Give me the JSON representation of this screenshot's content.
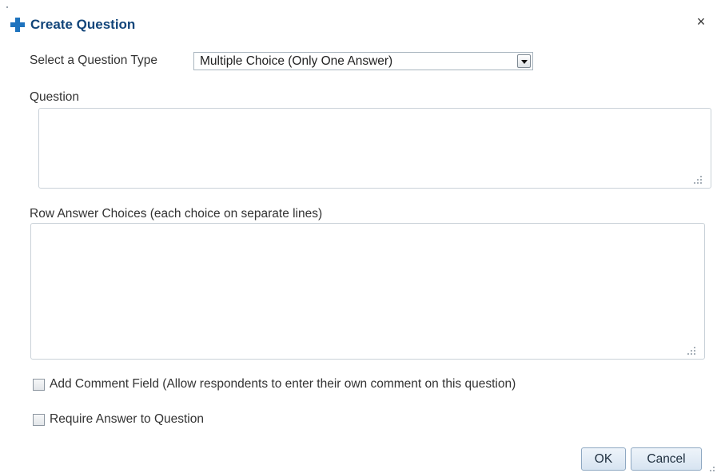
{
  "dialog": {
    "title": "Create Question",
    "close_symbol": "×",
    "icons": {
      "title_icon": "plus-icon",
      "close_icon": "close-icon"
    }
  },
  "question_type": {
    "label": "Select a Question Type",
    "selected": "Multiple Choice (Only One Answer)"
  },
  "question": {
    "label": "Question",
    "value": ""
  },
  "answers": {
    "label": "Row Answer Choices (each choice on separate lines)",
    "value": ""
  },
  "options": {
    "add_comment_label": "Add Comment Field (Allow respondents to enter their own comment on this question)",
    "add_comment_checked": false,
    "require_answer_label": "Require Answer to Question",
    "require_answer_checked": false
  },
  "buttons": {
    "ok": "OK",
    "cancel": "Cancel"
  },
  "colors": {
    "title": "#12457a",
    "plus_icon": "#1e73be",
    "text": "#333333"
  }
}
